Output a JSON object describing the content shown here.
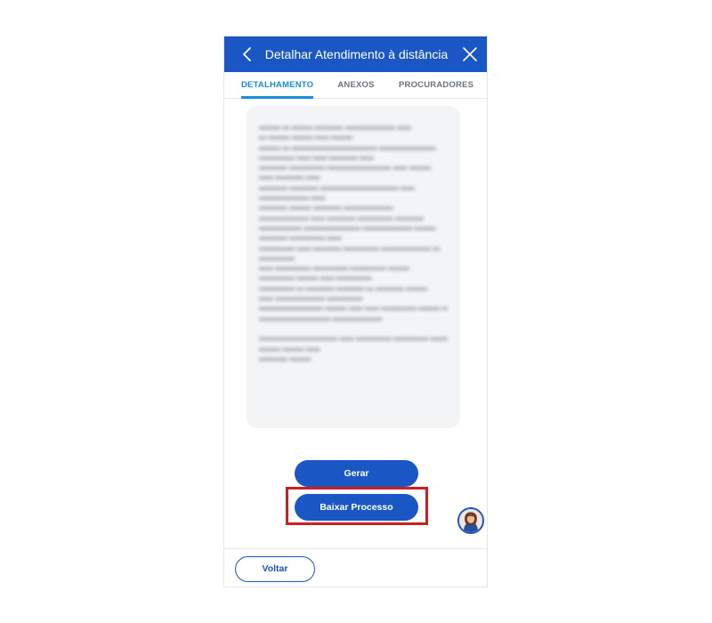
{
  "header": {
    "title": "Detalhar Atendimento à distância",
    "back_icon": "chevron-left-icon",
    "close_icon": "close-icon",
    "background": "#1a56c4"
  },
  "tabs": [
    {
      "label": "DETALHAMENTO",
      "active": true
    },
    {
      "label": "ANEXOS",
      "active": false
    },
    {
      "label": "PROCURADORES",
      "active": false
    }
  ],
  "document": {
    "blurred": true
  },
  "actions": {
    "gerar_label": "Gerar",
    "baixar_label": "Baixar Processo"
  },
  "highlight": {
    "target": "baixar-processo-button",
    "color": "#cc1f24"
  },
  "assistant": {
    "icon": "assistant-avatar"
  },
  "footer": {
    "voltar_label": "Voltar"
  },
  "colors": {
    "primary": "#1a56c4",
    "tab_active": "#1a8cd8",
    "card_bg": "#f3f4f6"
  }
}
